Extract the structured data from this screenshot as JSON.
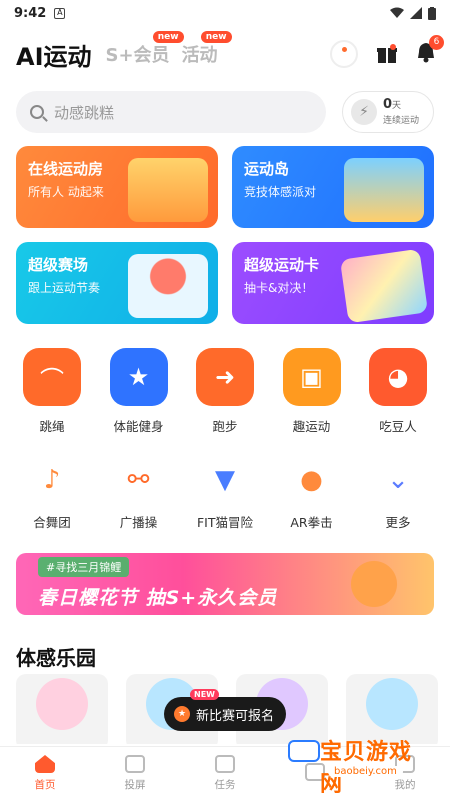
{
  "status": {
    "time": "9:42",
    "app_icon": "A"
  },
  "appbar": {
    "title": "AI运动",
    "tabs": [
      {
        "label": "S+会员",
        "badge": "new"
      },
      {
        "label": "活动",
        "badge": "new"
      }
    ],
    "notification_count": "6"
  },
  "search": {
    "placeholder": "动感跳糕"
  },
  "streak": {
    "count": "0",
    "unit": "天",
    "label": "连续运动"
  },
  "feature_cards": [
    {
      "title": "在线运动房",
      "subtitle": "所有人 动起来"
    },
    {
      "title": "运动岛",
      "subtitle": "竞技体感派对"
    },
    {
      "title": "超级赛场",
      "subtitle": "跟上运动节奏"
    },
    {
      "title": "超级运动卡",
      "subtitle": "抽卡&对决！"
    }
  ],
  "primary_grid": [
    {
      "label": "跳绳",
      "icon": "jump-rope-icon",
      "color": "#ff6a2a"
    },
    {
      "label": "体能健身",
      "icon": "fitness-icon",
      "color": "#2f73ff"
    },
    {
      "label": "跑步",
      "icon": "running-icon",
      "color": "#ff6a2a"
    },
    {
      "label": "趣运动",
      "icon": "fun-sports-icon",
      "color": "#ff9a1f"
    },
    {
      "label": "吃豆人",
      "icon": "pacman-icon",
      "color": "#ff5a2e"
    }
  ],
  "secondary_grid": [
    {
      "label": "合舞团",
      "icon": "dance-icon"
    },
    {
      "label": "广播操",
      "icon": "dumbbell-icon"
    },
    {
      "label": "FIT猫冒险",
      "icon": "cat-adventure-icon"
    },
    {
      "label": "AR拳击",
      "icon": "boxing-glove-icon"
    },
    {
      "label": "更多",
      "icon": "more-chevron-icon"
    }
  ],
  "banner": {
    "tag": "#寻找三月锦鲤",
    "text": "春日樱花节 抽S+永久会员"
  },
  "section": {
    "title": "体感乐园"
  },
  "toast": {
    "badge": "NEW",
    "text": "新比赛可报名"
  },
  "tabbar": {
    "items": [
      {
        "label": "首页",
        "active": true
      },
      {
        "label": "投屏"
      },
      {
        "label": "任务"
      },
      {
        "label": ""
      },
      {
        "label": "我的"
      }
    ]
  },
  "watermark": {
    "name": "宝贝游戏网",
    "url": "baobeiy.com"
  }
}
